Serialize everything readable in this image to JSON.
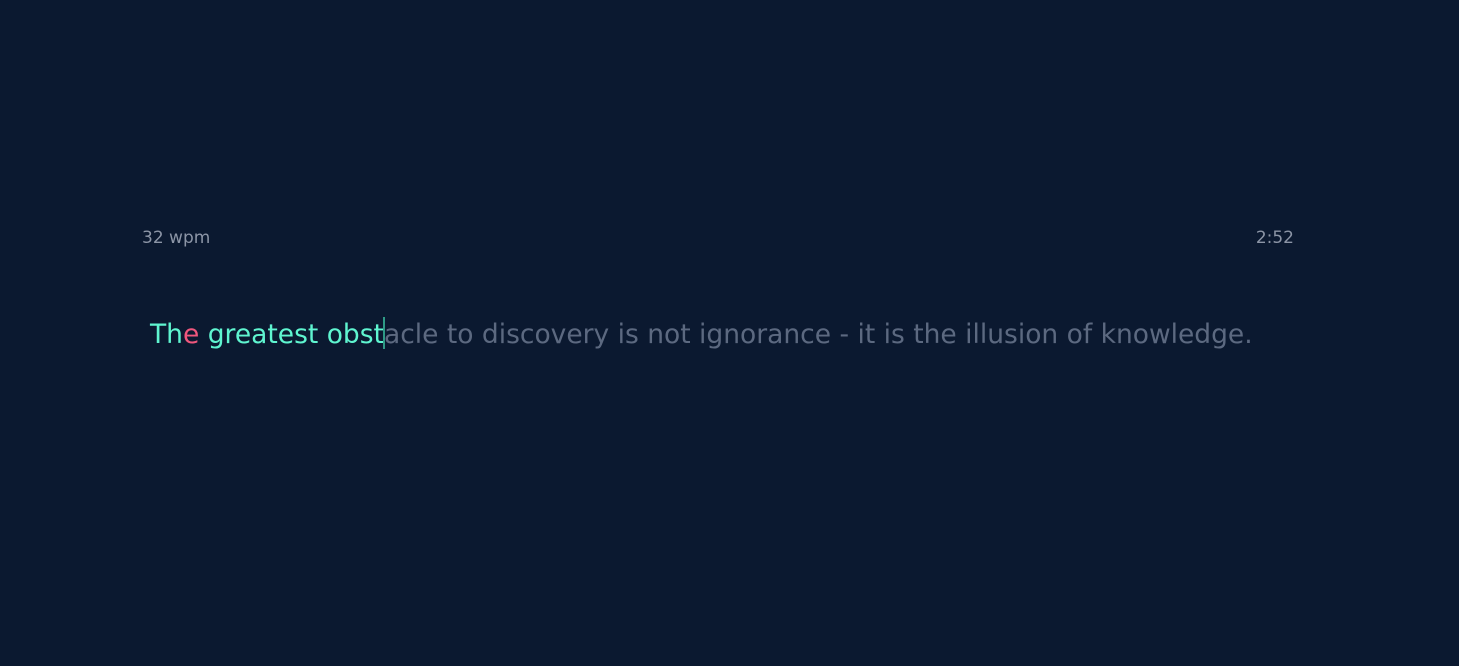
{
  "stats": {
    "wpm": "32 wpm",
    "timer": "2:52"
  },
  "colors": {
    "background": "#0b1930",
    "correct": "#5ff5d0",
    "incorrect": "#f0577d",
    "pending": "#5c6980",
    "caret": "#2e9a86",
    "stat_text": "#8c95a6"
  },
  "passage": {
    "typed_correct_1": "Th",
    "typed_incorrect_1": "e",
    "typed_correct_2": " greatest obst",
    "remaining": "acle to discovery is not ignorance - it is the illusion of knowledge."
  }
}
